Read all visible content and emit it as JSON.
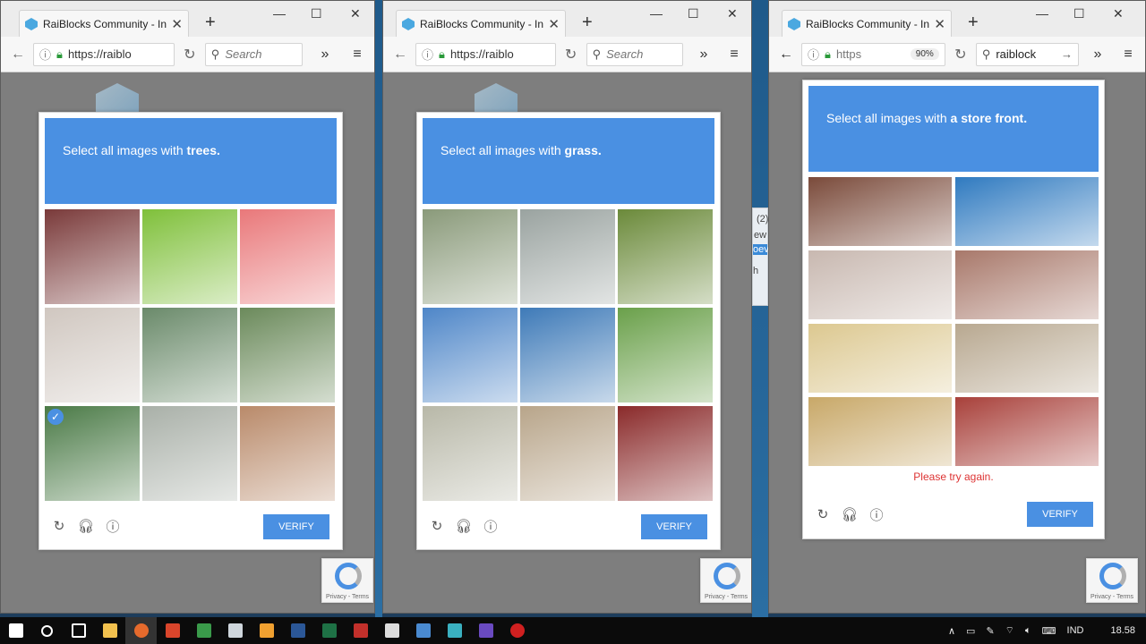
{
  "windows": [
    {
      "tab_title": "RaiBlocks Community - In...",
      "url": "https://raiblo",
      "search_placeholder": "Search",
      "prompt_lead": "Select all images with ",
      "prompt_subject": "trees.",
      "verify_label": "VERIFY",
      "tiles": [
        "#7a3a3a",
        "#7fc03a",
        "#e9787a",
        "#d0c7c0",
        "#6a8a6a",
        "#6b8a5b",
        "#4a7a46",
        "#a9b0a8",
        "#b98a6a"
      ],
      "selected_tile": 6
    },
    {
      "tab_title": "RaiBlocks Community - In...",
      "url": "https://raiblo",
      "search_placeholder": "Search",
      "prompt_lead": "Select all images with ",
      "prompt_subject": "grass.",
      "verify_label": "VERIFY",
      "tiles": [
        "#8a9a7a",
        "#9aa3a0",
        "#6b8a3a",
        "#4e86c8",
        "#3e7ab8",
        "#6aa04a",
        "#b8b8a8",
        "#b8a58a",
        "#8a2a2a"
      ]
    },
    {
      "tab_title": "RaiBlocks Community - In...",
      "url": "https",
      "zoom": "90%",
      "search_query": "raiblock",
      "prompt_lead": "Select all images with ",
      "prompt_subject": "a store front.",
      "verify_label": "VERIFY",
      "error_text": "Please try again.",
      "tiles": [
        "#7a4a3a",
        "#2f7ac0",
        "#c8b8b0",
        "#a8786a",
        "#dcc890",
        "#b8a890",
        "#c8a868",
        "#a8403a"
      ]
    }
  ],
  "badge": {
    "privacy_text": "Privacy - Terms"
  },
  "stray": {
    "t1": "(2)",
    "t2": "ew",
    "t3": "oev",
    "t4": "h"
  },
  "taskbar": {
    "language": "IND",
    "clock": "18.58",
    "icons": [
      "windows-start",
      "search",
      "task-view",
      "file-explorer",
      "firefox",
      "app-red",
      "app-green",
      "calculator",
      "app-orange",
      "word",
      "excel",
      "acrobat",
      "app-arrow",
      "app-blue",
      "app-teal",
      "visual-studio",
      "app-record"
    ]
  },
  "colors": {
    "accent": "#4a90e2",
    "error": "#dd3333"
  }
}
